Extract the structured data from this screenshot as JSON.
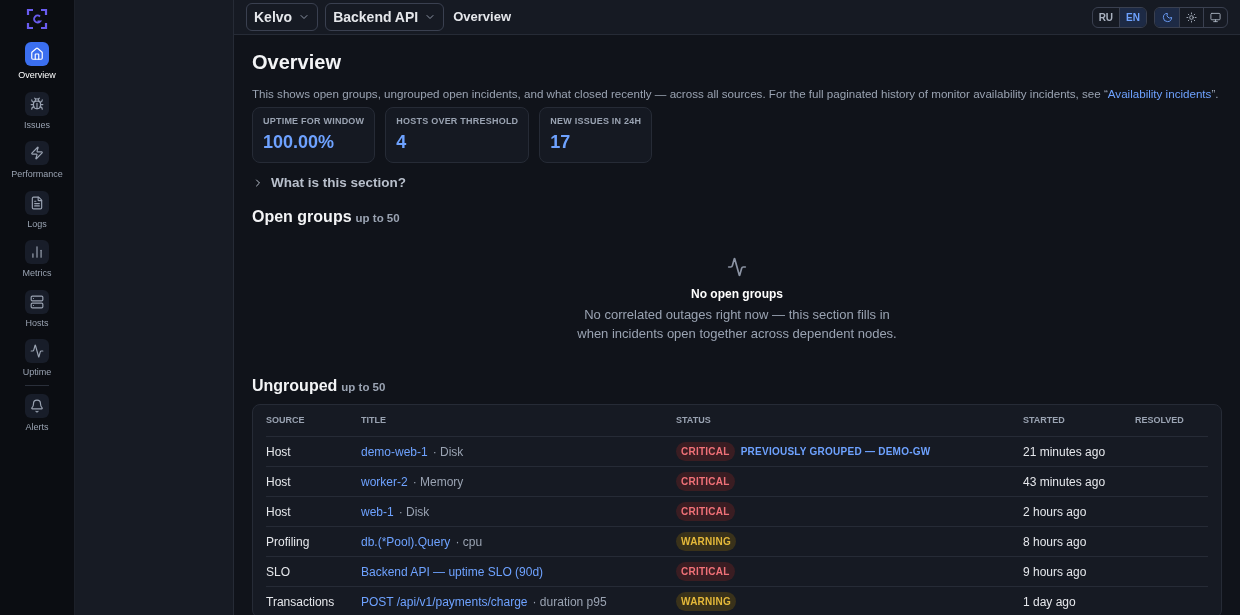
{
  "sidebar": {
    "items": [
      {
        "label": "Overview",
        "selected": true
      },
      {
        "label": "Issues",
        "selected": false
      },
      {
        "label": "Performance",
        "selected": false
      },
      {
        "label": "Logs",
        "selected": false
      },
      {
        "label": "Metrics",
        "selected": false
      },
      {
        "label": "Hosts",
        "selected": false
      },
      {
        "label": "Uptime",
        "selected": false
      },
      {
        "label": "Alerts",
        "selected": false
      }
    ]
  },
  "header": {
    "org": "Kelvo",
    "project": "Backend API",
    "breadcrumb": "Overview",
    "languages": [
      {
        "label": "RU",
        "selected": false
      },
      {
        "label": "EN",
        "selected": true
      }
    ],
    "themes": [
      {
        "kind": "dark",
        "selected": true
      },
      {
        "kind": "light",
        "selected": false
      },
      {
        "kind": "system",
        "selected": false
      }
    ]
  },
  "page": {
    "title": "Overview",
    "description": {
      "before": "This shows open groups, ungrouped open incidents, and what closed recently — across all sources. For the full paginated history of monitor availability incidents, see “",
      "link": "Availability incidents",
      "after": "”."
    },
    "stats": [
      {
        "label": "UPTIME FOR WINDOW",
        "value": "100.00%"
      },
      {
        "label": "HOSTS OVER THRESHOLD",
        "value": "4"
      },
      {
        "label": "NEW ISSUES IN 24H",
        "value": "17"
      }
    ],
    "disclosure": {
      "label": "What is this section?",
      "expanded": false
    }
  },
  "open_groups": {
    "title": "Open groups",
    "limit": "up to 50",
    "empty": {
      "title": "No open groups",
      "text": "No correlated outages right now — this section fills in when incidents open together across dependent nodes."
    }
  },
  "ungrouped": {
    "title": "Ungrouped",
    "limit": "up to 50",
    "columns": [
      "SOURCE",
      "TITLE",
      "STATUS",
      "STARTED",
      "RESOLVED"
    ],
    "rows": [
      {
        "source": "Host",
        "title": "demo-web-1",
        "detail": "· Disk",
        "status": "CRITICAL",
        "kind": "critical",
        "note": "PREVIOUSLY GROUPED — DEMO-GW",
        "started": "21 minutes ago"
      },
      {
        "source": "Host",
        "title": "worker-2",
        "detail": "· Memory",
        "status": "CRITICAL",
        "kind": "critical",
        "started": "43 minutes ago"
      },
      {
        "source": "Host",
        "title": "web-1",
        "detail": "· Disk",
        "status": "CRITICAL",
        "kind": "critical",
        "started": "2 hours ago"
      },
      {
        "source": "Profiling",
        "title": "db.(*Pool).Query",
        "detail": "· cpu",
        "status": "WARNING",
        "kind": "warning",
        "started": "8 hours ago"
      },
      {
        "source": "SLO",
        "title": "Backend API — uptime SLO (90d)",
        "status": "CRITICAL",
        "kind": "critical",
        "started": "9 hours ago"
      },
      {
        "source": "Transactions",
        "title": "POST /api/v1/payments/charge",
        "detail": "· duration p95",
        "status": "WARNING",
        "kind": "warning",
        "started": "1 day ago"
      }
    ]
  }
}
